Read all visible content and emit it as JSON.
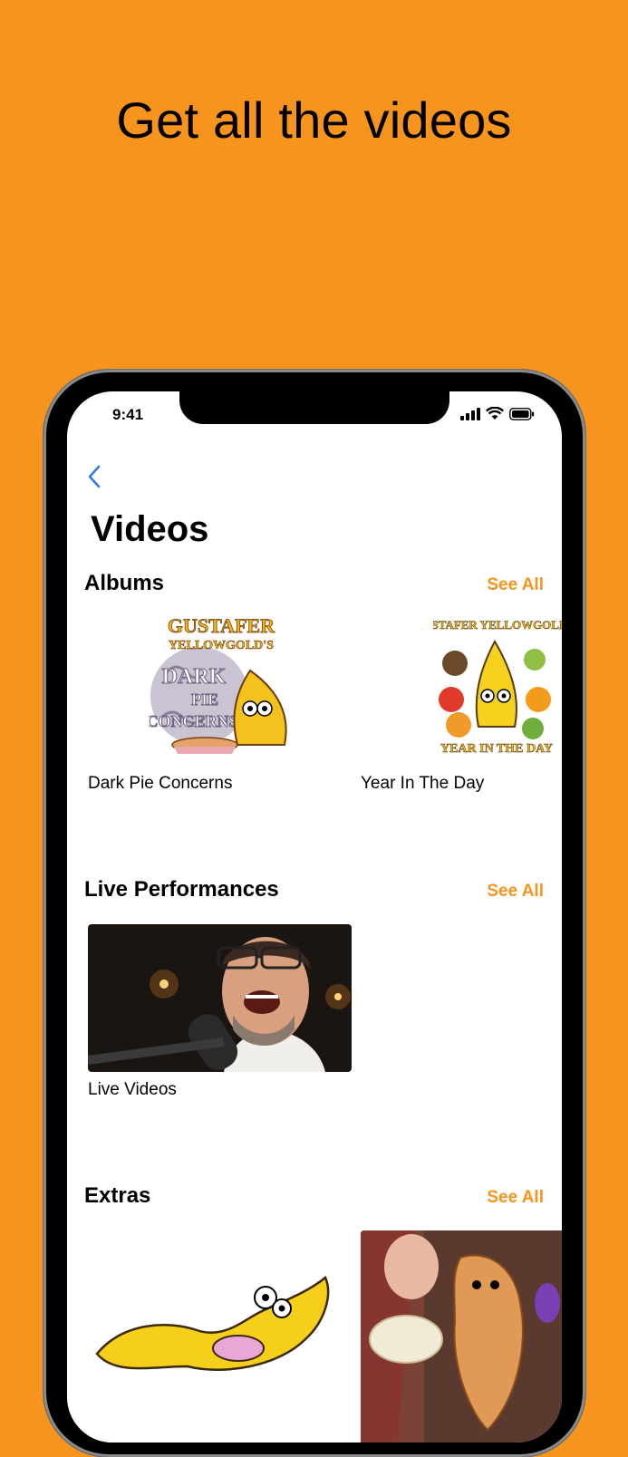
{
  "promo": {
    "headline": "Get all the videos"
  },
  "status_bar": {
    "time": "9:41"
  },
  "nav": {
    "title": "Videos"
  },
  "albums": {
    "title": "Albums",
    "see_all": "See All",
    "items": [
      {
        "caption": "Dark Pie Concerns",
        "art_text": [
          "GUSTAFER",
          "YELLOWGOLD'S",
          "DARK",
          "PIE",
          "CONCERNS"
        ]
      },
      {
        "caption": "Year In The Day",
        "art_text": [
          "GUSTAFER YELLOWGOLD's",
          "YEAR IN THE DAY"
        ]
      }
    ]
  },
  "live": {
    "title": "Live Performances",
    "see_all": "See All",
    "items": [
      {
        "caption": "Live Videos"
      }
    ]
  },
  "extras": {
    "title": "Extras",
    "see_all": "See All"
  },
  "colors": {
    "accent": "#F7941D",
    "back": "#2F7DE1"
  }
}
